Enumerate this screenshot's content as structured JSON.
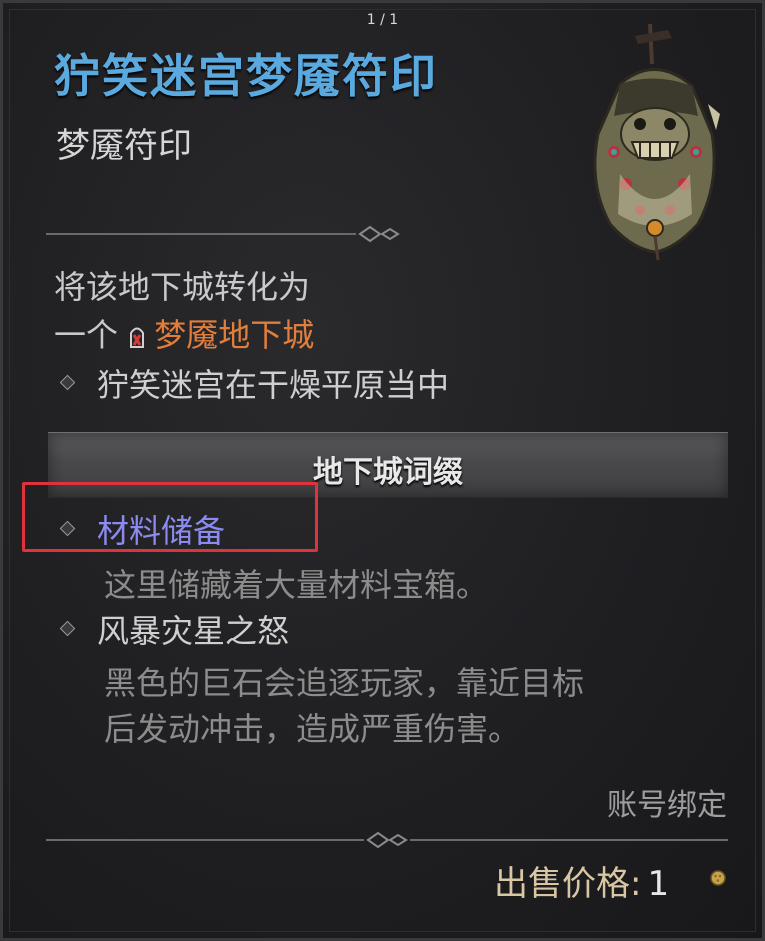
{
  "page_indicator": "1 / 1",
  "item": {
    "title": "狞笑迷宫梦魇符印",
    "type": "梦魇符印",
    "art_icon": "nightmare-sigil-art-icon"
  },
  "description": {
    "line1": "将该地下城转化为",
    "line2_prefix": "一个",
    "dungeon_icon": "nightmare-dungeon-icon",
    "dungeon_name": "梦魇地下城",
    "location": "狞笑迷宫在干燥平原当中"
  },
  "affix_section": {
    "header": "地下城词缀",
    "affixes": [
      {
        "name": "材料储备",
        "description_lines": [
          "这里储藏着大量材料宝箱。"
        ]
      },
      {
        "name": "风暴灾星之怒",
        "description_lines": [
          "黑色的巨石会追逐玩家，靠近目标",
          "后发动冲击，造成严重伤害。"
        ]
      }
    ]
  },
  "footer": {
    "account_bound": "账号绑定",
    "sell_price_label": "出售价格:",
    "sell_price_value": "1",
    "currency_icon": "gold-coin-icon"
  },
  "colors": {
    "title": "#5aa9df",
    "dungeon_name": "#df7e3d",
    "affix_name": "#8b8bef",
    "highlight": "#e0323c"
  }
}
